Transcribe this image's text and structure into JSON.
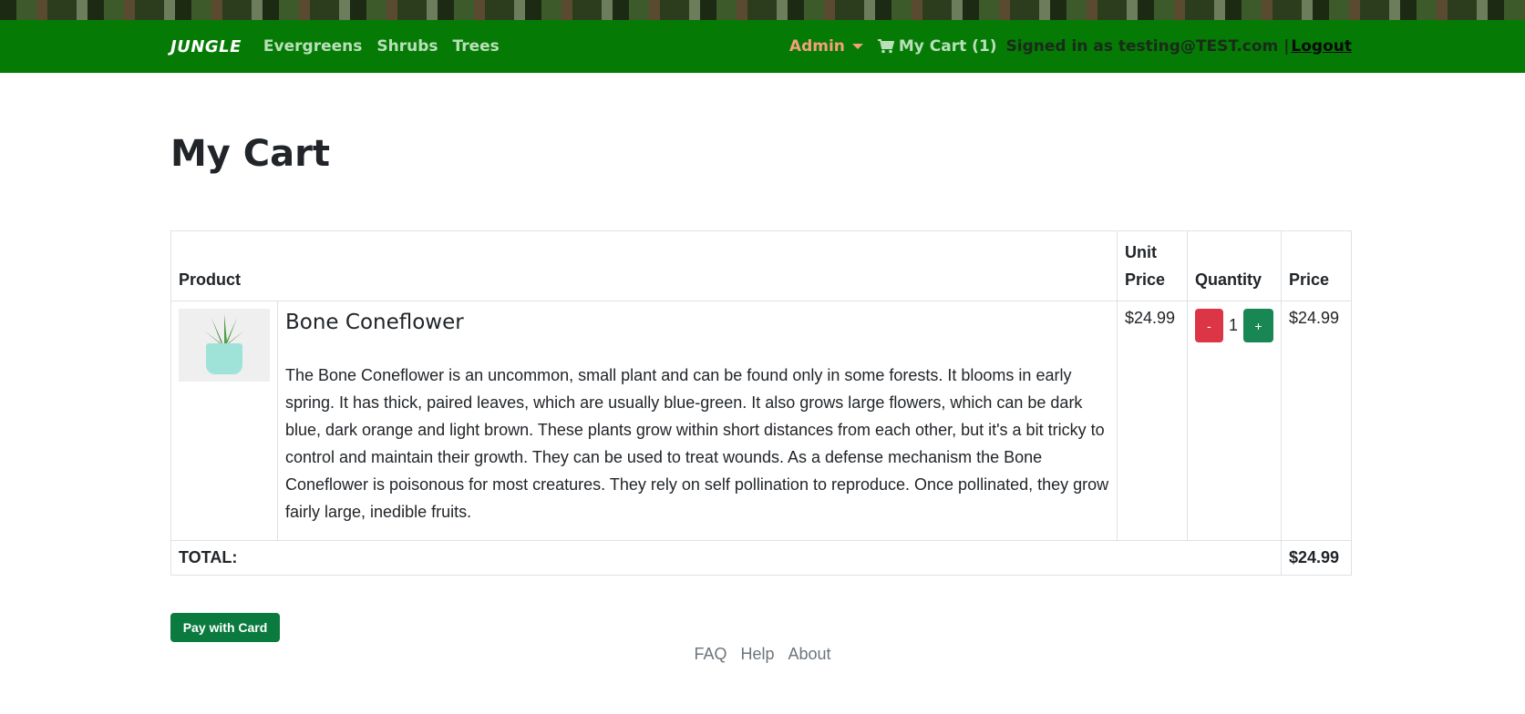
{
  "nav": {
    "brand": "JUNGLE",
    "links": [
      "Evergreens",
      "Shrubs",
      "Trees"
    ],
    "admin": "Admin",
    "cart": "My Cart (1)",
    "signed_in": "Signed in as testing@TEST.com |",
    "logout": "Logout"
  },
  "page": {
    "title": "My Cart"
  },
  "table": {
    "headers": {
      "product": "Product",
      "unit_price": "Unit Price",
      "quantity": "Quantity",
      "price": "Price"
    },
    "rows": [
      {
        "name": "Bone Coneflower",
        "description": "The Bone Coneflower is an uncommon, small plant and can be found only in some forests. It blooms in early spring. It has thick, paired leaves, which are usually blue-green. It also grows large flowers, which can be dark blue, dark orange and light brown. These plants grow within short distances from each other, but it's a bit tricky to control and maintain their growth. They can be used to treat wounds. As a defense mechanism the Bone Coneflower is poisonous for most creatures. They rely on self pollination to reproduce. Once pollinated, they grow fairly large, inedible fruits.",
        "unit_price": "$24.99",
        "quantity": "1",
        "minus": "-",
        "plus": "+",
        "price": "$24.99"
      }
    ],
    "total_label": "TOTAL:",
    "total_value": "$24.99"
  },
  "pay_button": "Pay with Card",
  "footer": [
    "FAQ",
    "Help",
    "About"
  ],
  "colors": {
    "navbar": "#057a05",
    "admin": "#f4a07a",
    "danger": "#dc3545",
    "success": "#198754"
  },
  "icons": {
    "cart": "shopping-cart-icon",
    "admin": "caret-down-icon"
  }
}
